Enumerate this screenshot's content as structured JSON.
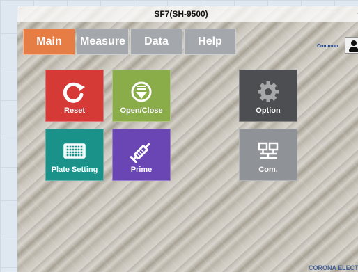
{
  "window": {
    "title": "SF7(SH-9500)",
    "control": "–"
  },
  "tabs": {
    "main": "Main",
    "measure": "Measure",
    "data": "Data",
    "help": "Help"
  },
  "user": {
    "label": "Common",
    "icon": "user-icon"
  },
  "tiles": {
    "reset": {
      "label": "Reset",
      "color": "#d63a37",
      "icon": "refresh-icon"
    },
    "open_close": {
      "label": "Open/Close",
      "color": "#8bad49",
      "icon": "eject-icon"
    },
    "option": {
      "label": "Option",
      "color": "#4c4e52",
      "icon": "gear-icon"
    },
    "plate_setting": {
      "label": "Plate Setting",
      "color": "#1a928a",
      "icon": "plate-grid-icon"
    },
    "prime": {
      "label": "Prime",
      "color": "#6a46b5",
      "icon": "syringe-icon"
    },
    "com": {
      "label": "Com.",
      "color": "#8f9296",
      "icon": "network-icon"
    }
  },
  "footer": {
    "brand": "CORONA ELECT"
  }
}
